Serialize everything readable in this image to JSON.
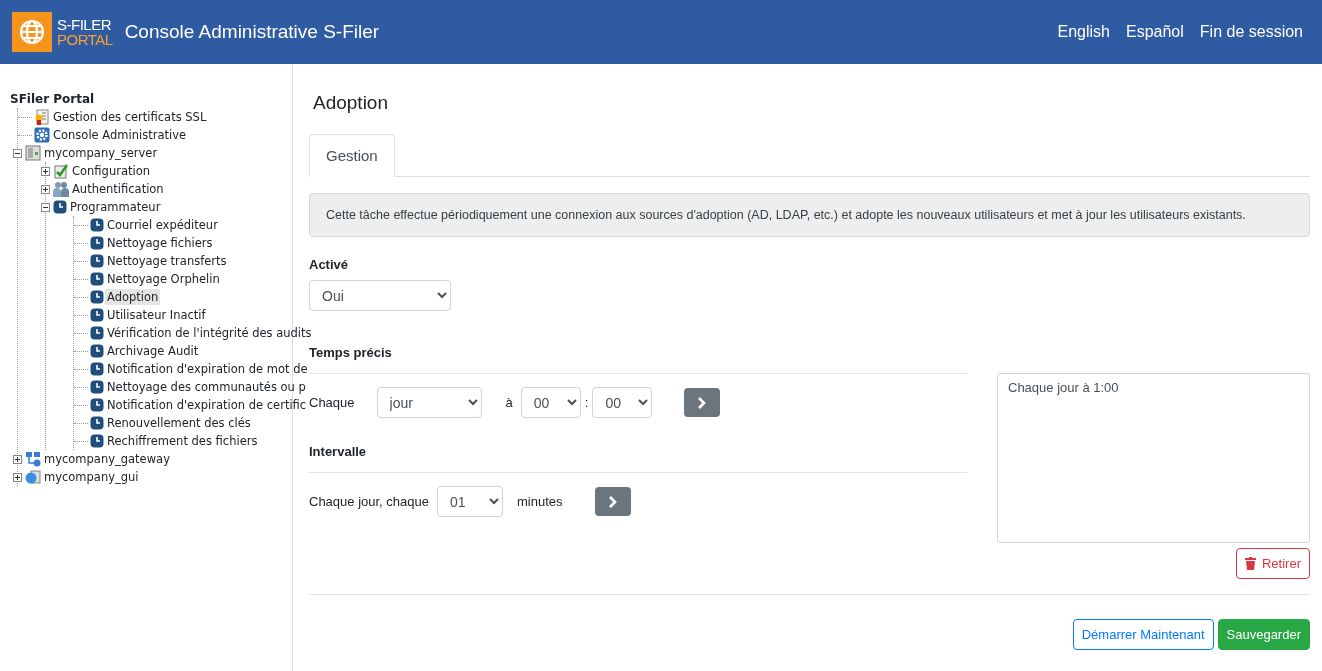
{
  "header": {
    "logo_line1": "S-FILER",
    "logo_line2": "PORTAL",
    "title": "Console Administrative S-Filer",
    "links": [
      "English",
      "Español",
      "Fin de session"
    ]
  },
  "tree": {
    "root": "SFiler Portal",
    "items": [
      {
        "label": "Gestion des certificats SSL",
        "kind": "certificate",
        "selected": false
      },
      {
        "label": "Console Administrative",
        "kind": "gear",
        "selected": false
      },
      {
        "label": "mycompany_server",
        "kind": "server",
        "expanded": true,
        "selected": false,
        "children": [
          {
            "label": "Configuration",
            "kind": "config",
            "expanded": false,
            "selected": false
          },
          {
            "label": "Authentification",
            "kind": "users",
            "expanded": false,
            "selected": false
          },
          {
            "label": "Programmateur",
            "kind": "clock",
            "expanded": true,
            "selected": false,
            "children": [
              {
                "label": "Courriel expéditeur",
                "kind": "clock",
                "selected": false
              },
              {
                "label": "Nettoyage fichiers",
                "kind": "clock",
                "selected": false
              },
              {
                "label": "Nettoyage transferts",
                "kind": "clock",
                "selected": false
              },
              {
                "label": "Nettoyage Orphelin",
                "kind": "clock",
                "selected": false
              },
              {
                "label": "Adoption",
                "kind": "clock",
                "selected": true
              },
              {
                "label": "Utilisateur Inactif",
                "kind": "clock",
                "selected": false
              },
              {
                "label": "Vérification de l'intégrité des audits",
                "kind": "clock",
                "selected": false
              },
              {
                "label": "Archivage Audit",
                "kind": "clock",
                "selected": false
              },
              {
                "label": "Notification d'expiration de mot de",
                "kind": "clock",
                "selected": false
              },
              {
                "label": "Nettoyage des communautés ou p",
                "kind": "clock",
                "selected": false
              },
              {
                "label": "Notification d'expiration de certific",
                "kind": "clock",
                "selected": false
              },
              {
                "label": "Renouvellement des clés",
                "kind": "clock",
                "selected": false
              },
              {
                "label": "Rechiffrement des fichiers",
                "kind": "clock",
                "selected": false
              }
            ]
          }
        ]
      },
      {
        "label": "mycompany_gateway",
        "kind": "gateway",
        "expanded": false,
        "selected": false
      },
      {
        "label": "mycompany_gui",
        "kind": "gui",
        "expanded": false,
        "selected": false
      }
    ]
  },
  "page": {
    "title": "Adoption",
    "tabs": [
      {
        "label": "Gestion",
        "selected": true
      }
    ],
    "description": "Cette tâche effectue périodiquement une connexion aux sources d'adoption (AD, LDAP, etc.) et adopte les nouveaux utilisateurs et met à jour les utilisateurs existants.",
    "enabled": {
      "label": "Activé",
      "value": "Oui"
    },
    "precise": {
      "heading": "Temps précis",
      "every_label": "Chaque",
      "unit": "jour",
      "at_label": "à",
      "hour": "00",
      "separator": ":",
      "minute": "00"
    },
    "interval": {
      "heading": "Intervalle",
      "prefix": "Chaque jour, chaque",
      "value": "01",
      "suffix": "minutes"
    },
    "schedule_text": "Chaque jour à 1:00",
    "remove_button": "Retirer",
    "start_button": "Démarrer Maintenant",
    "save_button": "Sauvegarder"
  }
}
